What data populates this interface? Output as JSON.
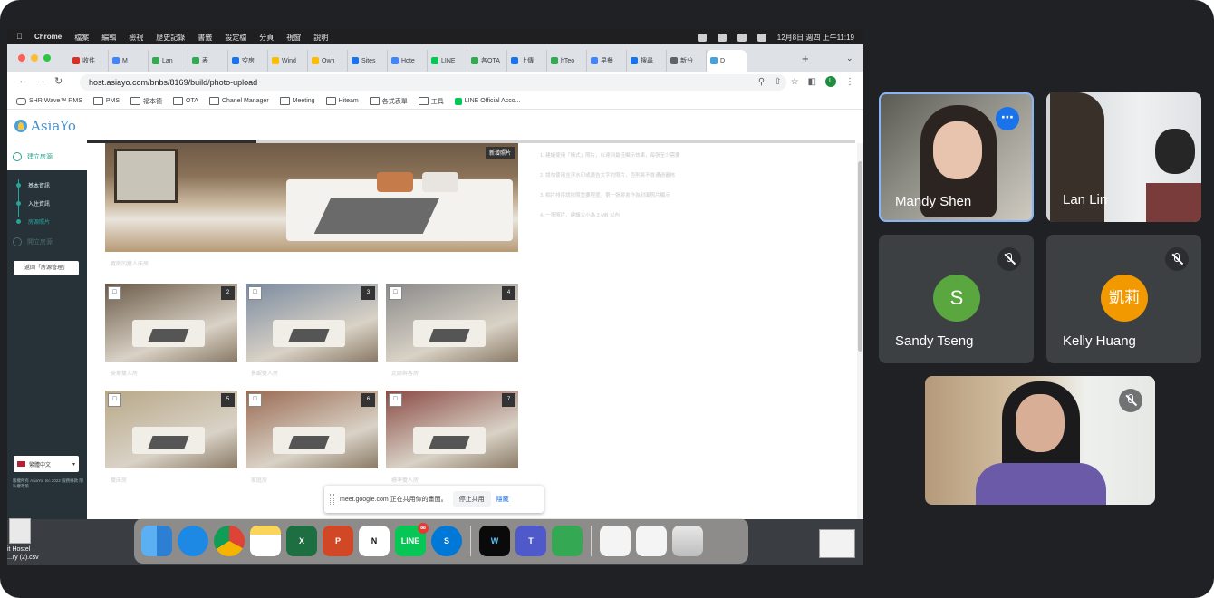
{
  "menubar": {
    "items": [
      "Chrome",
      "檔案",
      "編輯",
      "檢視",
      "歷史記錄",
      "書籤",
      "設定檔",
      "分頁",
      "視窗",
      "說明"
    ],
    "clock": "12月8日 週四 上午11:19"
  },
  "tabs": [
    {
      "label": "收件",
      "color": "#d93025"
    },
    {
      "label": "M",
      "color": "#4285f4"
    },
    {
      "label": "Lan",
      "color": "#34a853"
    },
    {
      "label": "表",
      "color": "#34a853"
    },
    {
      "label": "空房",
      "color": "#1a73e8"
    },
    {
      "label": "Wind",
      "color": "#fbbc04"
    },
    {
      "label": "Owh",
      "color": "#fbbc04"
    },
    {
      "label": "Sites",
      "color": "#1a73e8"
    },
    {
      "label": "Hote",
      "color": "#4285f4"
    },
    {
      "label": "LINE",
      "color": "#06c755"
    },
    {
      "label": "各OTA",
      "color": "#34a853"
    },
    {
      "label": "上傳",
      "color": "#1a73e8"
    },
    {
      "label": "hTeo",
      "color": "#34a853"
    },
    {
      "label": "早餐",
      "color": "#4285f4"
    },
    {
      "label": "搜尋",
      "color": "#1a73e8"
    },
    {
      "label": "新分",
      "color": "#5f6368"
    },
    {
      "label": "D",
      "color": "#4aa0d8"
    }
  ],
  "browser": {
    "url": "host.asiayo.com/bnbs/8169/build/photo-upload",
    "profile_initial": "L",
    "bookmarks": [
      "SHR Wave™ RMS",
      "PMS",
      "福本德",
      "OTA",
      "Chanel Manager",
      "Meeting",
      "Hiteam",
      "各式表單",
      "工具",
      "LINE Official Acco..."
    ]
  },
  "page": {
    "brand": "AsiaYo",
    "nav_build": "建立房源",
    "nav_steps": [
      "基本資訊",
      "入住資訊",
      "房源照片"
    ],
    "nav_publish": "開立房源",
    "back_button": "返回「房源管理」",
    "language": "繁體中文",
    "footnote": "版權所有 AsiaYo, Inc 2022 服務條款 隱私權政策",
    "hero_tag": "新增照片",
    "hero_caption": "寬敞的雙人床房",
    "progress": 0.22,
    "photos": [
      {
        "n": "2",
        "caption": "豪華雙人房",
        "bg": "#6b5a48"
      },
      {
        "n": "3",
        "caption": "景觀雙人房",
        "bg": "#7a8aa0"
      },
      {
        "n": "4",
        "caption": "走廊與客房",
        "bg": "#8a8a8a"
      },
      {
        "n": "5",
        "caption": "雙床房",
        "bg": "#b8a888"
      },
      {
        "n": "6",
        "caption": "家庭房",
        "bg": "#9a6a52"
      },
      {
        "n": "7",
        "caption": "標準雙人房",
        "bg": "#8a4a44"
      }
    ],
    "tips": [
      "1. 建議使用「橫式」照片，以達到最佳顯示效果，每張至少需要",
      "2. 請勿使用含浮水印或廣告文字的照片，否則將不會通過審核",
      "3. 相片排序請依照重要程度，第一張將會作為封面照片顯示",
      "4. 一張照片，建議大小為 3 MB 以內"
    ]
  },
  "share": {
    "text": "meet.google.com 正在共用你的畫面。",
    "stop": "停止共用",
    "hide": "隱藏"
  },
  "dock": [
    "Finder",
    "Safari",
    "Chrome",
    "Notes",
    "Excel",
    "PowerPoint",
    "Notion",
    "LINE",
    "Skype",
    "Webex",
    "Teams",
    "Numbers"
  ],
  "dock_badge": "88",
  "desktop": {
    "label_1": "it Hostel",
    "label_2": "...ry (2).csv"
  },
  "participants": [
    {
      "name": "Mandy Shen",
      "video": true
    },
    {
      "name": "Lan Lin",
      "video": true
    },
    {
      "name": "Sandy Tseng",
      "initial": "S",
      "color": "#5aa63f"
    },
    {
      "name": "Kelly Huang",
      "initial": "凱莉",
      "color": "#f29900"
    },
    {
      "name": "",
      "video": true
    }
  ]
}
